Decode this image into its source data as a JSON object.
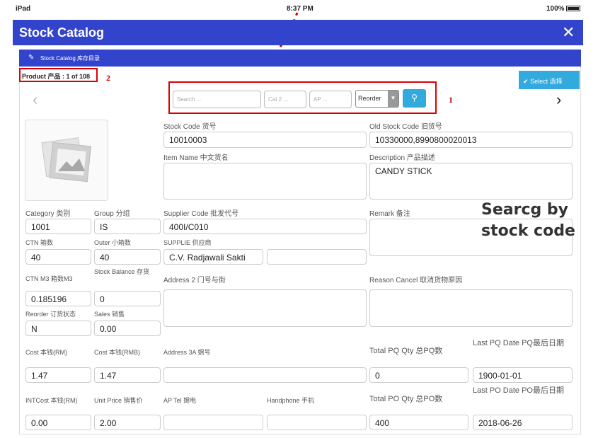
{
  "status": {
    "device": "iPad",
    "time": "8:37 PM",
    "battery": "100%"
  },
  "header": {
    "title": "Stock Catalog",
    "close_icon": "close-icon"
  },
  "subheader": {
    "label": "Stock Catalog 库存目录"
  },
  "product_count": "Product 产品 : 1 of 108",
  "annotations": {
    "one": "1",
    "two": "2",
    "overlay_line1": "Searcg by",
    "overlay_line2": "stock code"
  },
  "select_button": "Select 选择",
  "search": {
    "search_placeholder": "Search ...",
    "cat2_placeholder": "Cat 2 ...",
    "ap_placeholder": "AP ...",
    "selected": "Reorder"
  },
  "fields": {
    "stock_code": {
      "label": "Stock Code 货号",
      "value": "10010003"
    },
    "old_stock_code": {
      "label": "Old Stock Code 旧货号",
      "value": "10330000,8990800020013"
    },
    "item_name": {
      "label": "Item Name 中文货名",
      "value": ""
    },
    "description": {
      "label": "Description 产品描述",
      "value": "CANDY STICK"
    },
    "category": {
      "label": "Category 类别",
      "value": "1001"
    },
    "group": {
      "label": "Group 分组",
      "value": "IS"
    },
    "supplier_code": {
      "label": "Supplier Code 批发代号",
      "value": "400I/C010"
    },
    "remark": {
      "label": "Remark 备注",
      "value": ""
    },
    "ctn": {
      "label": "CTN 箱数",
      "value": "40"
    },
    "outer": {
      "label": "Outer 小箱数",
      "value": "40"
    },
    "supplie": {
      "label": "SUPPLIE 供应商",
      "value": "C.V. Radjawali Sakti"
    },
    "ctn_m3": {
      "label": "CTN M3 箱数M3",
      "value": "0.185196"
    },
    "stock_balance": {
      "label": "Stock Balance 存货",
      "value": "0"
    },
    "address2": {
      "label": "Address 2 门号与街",
      "value": ""
    },
    "reason_cancel": {
      "label": "Reason Cancel 取消货物原因",
      "value": ""
    },
    "reorder": {
      "label": "Reorder 订货状态",
      "value": "N"
    },
    "sales": {
      "label": "Sales 销售",
      "value": "0.00"
    },
    "cost_rm": {
      "label": "Cost 本钱(RM)",
      "value": "1.47"
    },
    "cost_rmb": {
      "label": "Cost 本钱(RMB)",
      "value": "1.47"
    },
    "address3a": {
      "label": "Address 3A 嫦号",
      "value": ""
    },
    "total_pq_qty": {
      "label": "Total PQ Qty 总PQ数",
      "value": "0"
    },
    "last_pq_date": {
      "label": "Last PQ Date PQ最后日期",
      "value": "1900-01-01"
    },
    "intcost_rm": {
      "label": "INTCost 本钱(RM)",
      "value": "0.00"
    },
    "unit_price": {
      "label": "Unit Price 销售价",
      "value": "2.00"
    },
    "ap_tel": {
      "label": "AP Tel 嫦电",
      "value": ""
    },
    "handphone": {
      "label": "Handphone 手机",
      "value": ""
    },
    "total_po_qty": {
      "label": "Total PO Qty 总PO数",
      "value": "400"
    },
    "last_po_date": {
      "label": "Last PO Date PO最后日期",
      "value": "2018-06-26"
    }
  }
}
